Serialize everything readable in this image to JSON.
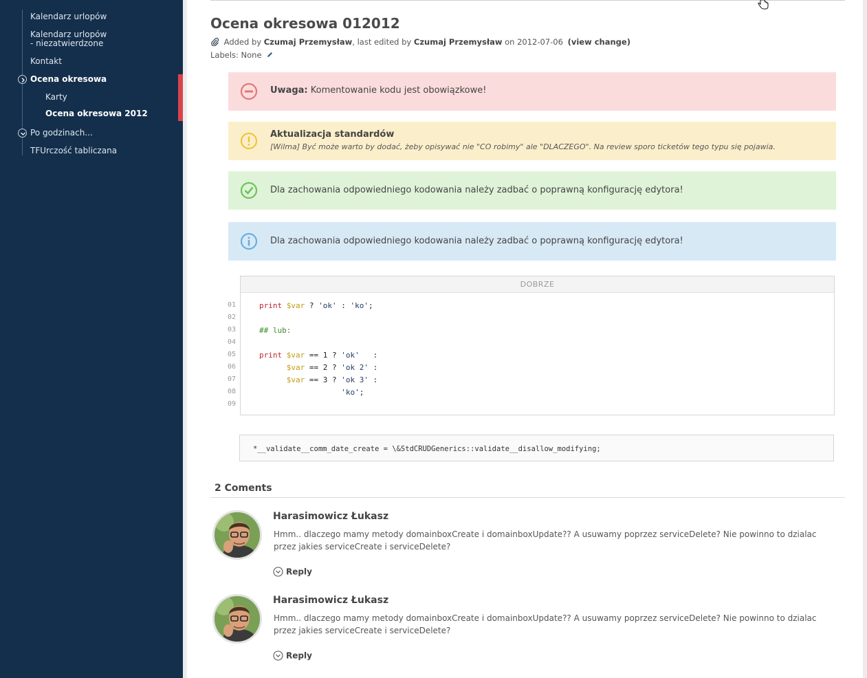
{
  "sidebar": {
    "items": [
      {
        "label": "Kalendarz urlopów"
      },
      {
        "label": "Kalendarz urlopów"
      },
      {
        "label": "- niezatwierdzone"
      },
      {
        "label": "Kontakt"
      },
      {
        "label": "Ocena okresowa"
      },
      {
        "label": "Karty"
      },
      {
        "label": "Ocena okresowa 2012"
      },
      {
        "label": "Po godzinach..."
      },
      {
        "label": "TFUrczość tabliczana"
      }
    ]
  },
  "page": {
    "title": "Ocena okresowa 012012",
    "meta": {
      "added_by_prefix": "Added by",
      "added_by": "Czumaj Przemysław",
      "edited_prefix": ", last edited by",
      "edited_by": "Czumaj Przemysław",
      "on_prefix": "on 2012-07-06",
      "view_change": "(view change)"
    },
    "labels": "Labels: None"
  },
  "panels": {
    "error": {
      "bold": "Uwaga:",
      "text": "Komentowanie kodu jest obowiązkowe!"
    },
    "warning": {
      "title": "Aktualizacja standardów",
      "text": "[Wilma] Być może warto by dodać, żeby opisywać nie \"CO robimy\" ale \"DLACZEGO\". Na review sporo ticketów tego typu się pojawia."
    },
    "success": {
      "text": "Dla zachowania odpowiedniego kodowania należy zadbać o poprawną konfigurację edytora!"
    },
    "info": {
      "text": "Dla zachowania odpowiedniego kodowania należy zadbać o poprawną konfigurację edytora!"
    }
  },
  "code": {
    "header": "DOBRZE",
    "line_numbers": [
      "01",
      "02",
      "03",
      "04",
      "05",
      "06",
      "07",
      "08",
      "09"
    ],
    "tokens": {
      "print": "print",
      "var": "$var",
      "comment": "## lub:",
      "l1_rest": " ? ",
      "l1_ok": "'ok'",
      "l1_colon": " : ",
      "l1_ko": "'ko'",
      "semi": ";",
      "l5_mid": " == 1 ? ",
      "l5_ok": "'ok'",
      "l5_tail": "   :",
      "l6_mid": " == 2 ? ",
      "l6_ok": "'ok 2'",
      "l6_tail": " :",
      "l7_mid": " == 3 ? ",
      "l7_ok": "'ok 3'",
      "l7_tail": " :",
      "l8_ko": "'ko'",
      "indent1": "      ",
      "indent2": "                  "
    },
    "inline": "*__validate__comm_date_create = \\&StdCRUDGenerics::validate__disallow_modifying;"
  },
  "comments": {
    "title": "2 Coments",
    "items": [
      {
        "author": "Harasimowicz Łukasz",
        "text": "Hmm.. dlaczego mamy metody domainboxCreate i domainboxUpdate?? A usuwamy poprzez serviceDelete?  Nie powinno to dzialac przez jakies serviceCreate i serviceDelete?",
        "reply": "Reply"
      },
      {
        "author": "Harasimowicz Łukasz",
        "text": "Hmm.. dlaczego mamy metody domainboxCreate i domainboxUpdate?? A usuwamy poprzez serviceDelete? Nie powinno to dzialac przez jakies serviceCreate i serviceDelete?",
        "reply": "Reply"
      }
    ]
  },
  "icons": {
    "error": "minus-circle-icon",
    "warning": "exclamation-circle-icon",
    "success": "check-circle-icon",
    "info": "info-circle-icon",
    "attachment": "paperclip-icon",
    "edit": "pencil-icon",
    "reply": "chevron-down-circle-icon",
    "cursor": "hand-cursor-icon"
  },
  "colors": {
    "sidebar": "#142f4c",
    "active": "#d9434a",
    "error_bg": "#fbdcdd",
    "warning_bg": "#fbefcb",
    "success_bg": "#dff3d8",
    "info_bg": "#d8e9f6"
  }
}
